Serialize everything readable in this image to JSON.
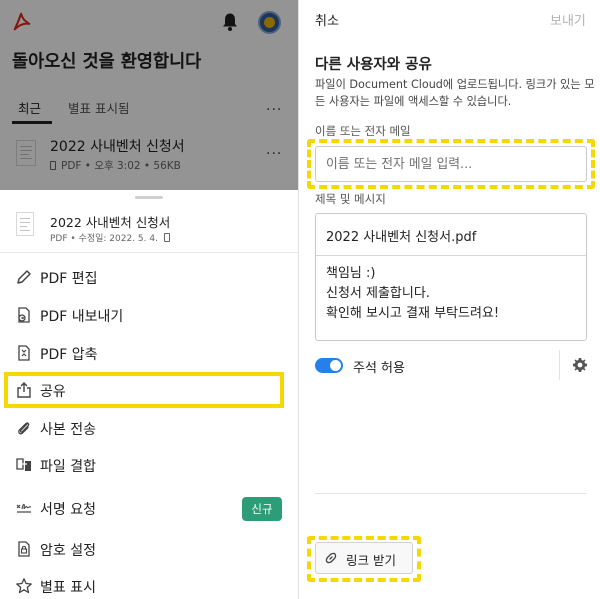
{
  "home": {
    "welcome": "돌아오신 것을 환영합니다",
    "tabs": [
      "최근",
      "별표 표시됨"
    ],
    "more": "...",
    "recent_file": {
      "name": "2022 사내벤처 신청서",
      "meta": "PDF • 오후 3:02 • 56KB"
    }
  },
  "sheet": {
    "file_name": "2022 사내벤처 신청서",
    "file_meta": "PDF • 수정일: 2022. 5. 4.",
    "menu": [
      {
        "label": "PDF 편집",
        "icon": "pencil-icon"
      },
      {
        "label": "PDF 내보내기",
        "icon": "export-pdf-icon"
      },
      {
        "label": "PDF 압축",
        "icon": "compress-pdf-icon"
      },
      {
        "label": "공유",
        "icon": "share-icon"
      },
      {
        "label": "사본 전송",
        "icon": "paperclip-icon"
      },
      {
        "label": "파일 결합",
        "icon": "combine-files-icon"
      },
      {
        "label": "서명 요청",
        "icon": "signature-icon"
      },
      {
        "label": "암호 설정",
        "icon": "password-icon"
      },
      {
        "label": "별표 표시",
        "icon": "star-icon"
      }
    ],
    "new_badge": "신규"
  },
  "share_panel": {
    "cancel": "취소",
    "send": "보내기",
    "title": "다른 사용자와 공유",
    "description": "파일이 Document Cloud에 업로드됩니다. 링크가 있는 모든 사용자는 파일에 액세스할 수 있습니다.",
    "recipient_label": "이름 또는 전자 메일",
    "recipient_placeholder": "이름 또는 전자 메일 입력...",
    "message_label": "제목 및 메시지",
    "subject": "2022 사내벤처 신청서.pdf",
    "message_lines": [
      "책임님 :)",
      "신청서 제출합니다.",
      "확인해 보시고 결재 부탁드려요!"
    ],
    "allow_comments": "주석 허용",
    "allow_comments_on": true,
    "get_link": "링크 받기"
  },
  "colors": {
    "acrobat_red": "#e0261b",
    "highlight_yellow": "#f5d800",
    "toggle_blue": "#2680eb",
    "badge_green": "#2d9d78"
  }
}
